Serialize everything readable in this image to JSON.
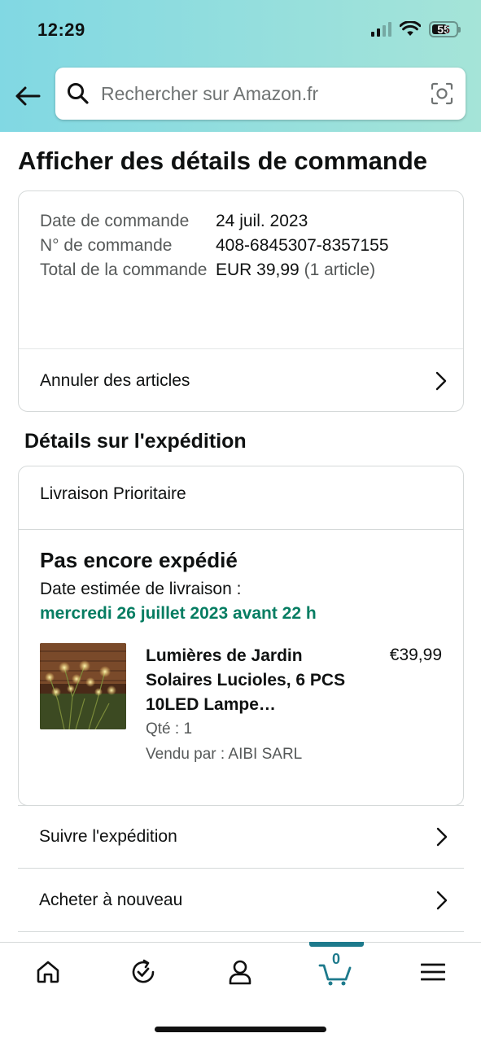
{
  "status_bar": {
    "time": "12:29",
    "battery": "55"
  },
  "search": {
    "placeholder": "Rechercher sur Amazon.fr"
  },
  "page": {
    "title": "Afficher des détails de commande"
  },
  "order_summary": {
    "rows": [
      {
        "label": "Date de commande",
        "value": "24 juil. 2023",
        "extra": ""
      },
      {
        "label": "N° de commande",
        "value": "408-6845307-8357155",
        "extra": ""
      },
      {
        "label": "Total de la commande",
        "value": "EUR 39,99",
        "extra": "(1 article)"
      }
    ],
    "cancel_label": "Annuler des articles"
  },
  "shipment": {
    "section_title": "Détails sur l'expédition",
    "method": "Livraison Prioritaire",
    "status": "Pas encore expédié",
    "estimate_label": "Date estimée de livraison :",
    "estimate_date": "mercredi 26 juillet 2023 avant 22 h",
    "product": {
      "title": "Lumières de Jardin Solaires Lucioles, 6 PCS 10LED Lampe…",
      "price": "€39,99",
      "qty": "Qté : 1",
      "seller": "Vendu par : AIBI SARL"
    }
  },
  "links": {
    "track": "Suivre l'expédition",
    "buy_again": "Acheter à nouveau"
  },
  "bottom_nav": {
    "cart_count": "0",
    "items": [
      "home-icon",
      "refresh-check-icon",
      "account-icon",
      "cart-icon",
      "menu-icon"
    ],
    "accent": "#1d7a8c"
  },
  "colors": {
    "delivery_green": "#067d62",
    "header_gradient_start": "#81d8e3",
    "header_gradient_end": "#a5e4d8"
  }
}
